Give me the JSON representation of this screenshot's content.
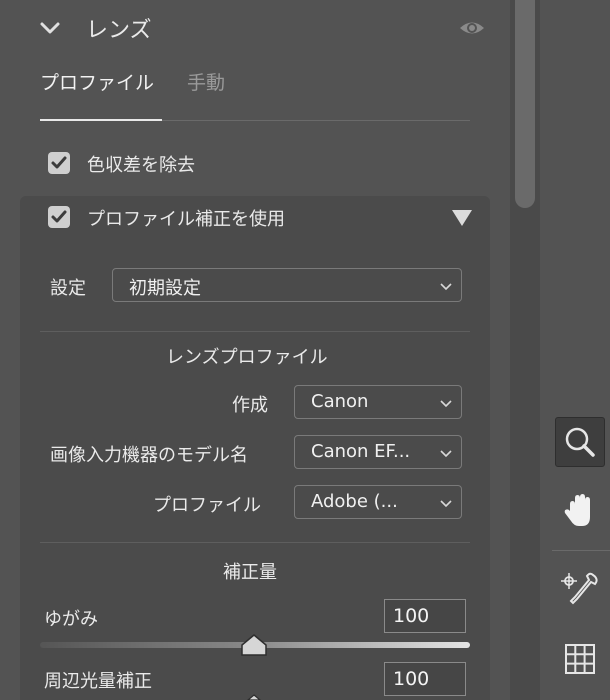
{
  "section": {
    "title": "レンズ",
    "icons": {
      "collapse": "chevron-down-icon",
      "visibility": "eye-icon"
    }
  },
  "tabs": [
    {
      "label": "プロファイル",
      "active": true
    },
    {
      "label": "手動",
      "active": false
    }
  ],
  "chromatic_aberration": {
    "label": "色収差を除去",
    "checked": true
  },
  "profile_correction": {
    "label": "プロファイル補正を使用",
    "checked": true
  },
  "settings": {
    "label": "設定",
    "value": "初期設定"
  },
  "lens_profile": {
    "heading": "レンズプロファイル",
    "make": {
      "label": "作成",
      "value": "Canon"
    },
    "model": {
      "label": "画像入力機器のモデル名",
      "value": "Canon EF..."
    },
    "profile": {
      "label": "プロファイル",
      "value": "Adobe (..."
    }
  },
  "amount": {
    "heading": "補正量",
    "distortion": {
      "label": "ゆがみ",
      "value": "100"
    },
    "vignetting": {
      "label": "周辺光量補正",
      "value": "100"
    }
  },
  "toolbar": {
    "tools": [
      "zoom-icon",
      "hand-icon",
      "color-sampler-icon",
      "grid-icon"
    ],
    "active": "zoom-icon"
  },
  "colors": {
    "panel": "#535353",
    "subpanel": "#4b4b4b",
    "text": "#eaeaea"
  }
}
